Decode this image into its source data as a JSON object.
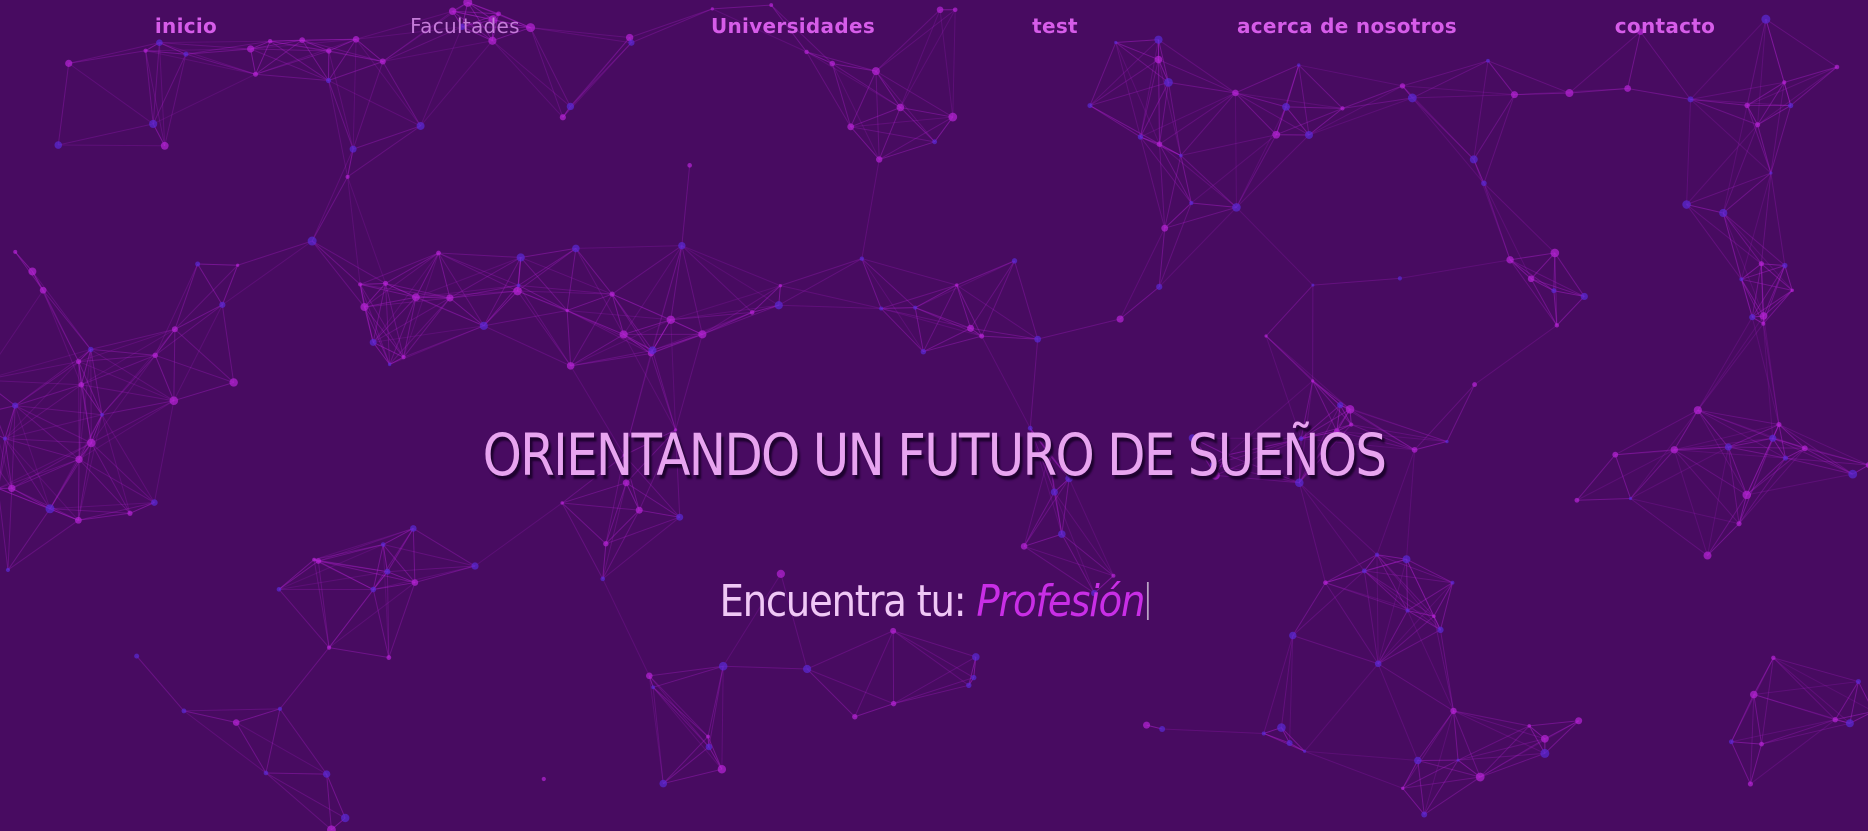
{
  "nav": {
    "items": [
      {
        "label": "inicio",
        "name": "nav-inicio"
      },
      {
        "label": "Facultades",
        "name": "nav-facultades"
      },
      {
        "label": "Universidades",
        "name": "nav-universidades"
      },
      {
        "label": "test",
        "name": "nav-test"
      },
      {
        "label": "acerca de nosotros",
        "name": "nav-acerca"
      },
      {
        "label": "contacto",
        "name": "nav-contacto"
      }
    ]
  },
  "hero": {
    "title": "ORIENTANDO UN FUTURO DE SUEÑOS",
    "subtitle_prefix": "Encuentra tu:",
    "typed_word": "Profesión"
  },
  "colors": {
    "background": "#480b61",
    "nav_link": "#d65ce9",
    "title": "#e8a4f0",
    "typed": "#c92ee6",
    "network_line": "#b623d6",
    "network_node": "#5a2ad6"
  },
  "background_decoration": "particle-network"
}
